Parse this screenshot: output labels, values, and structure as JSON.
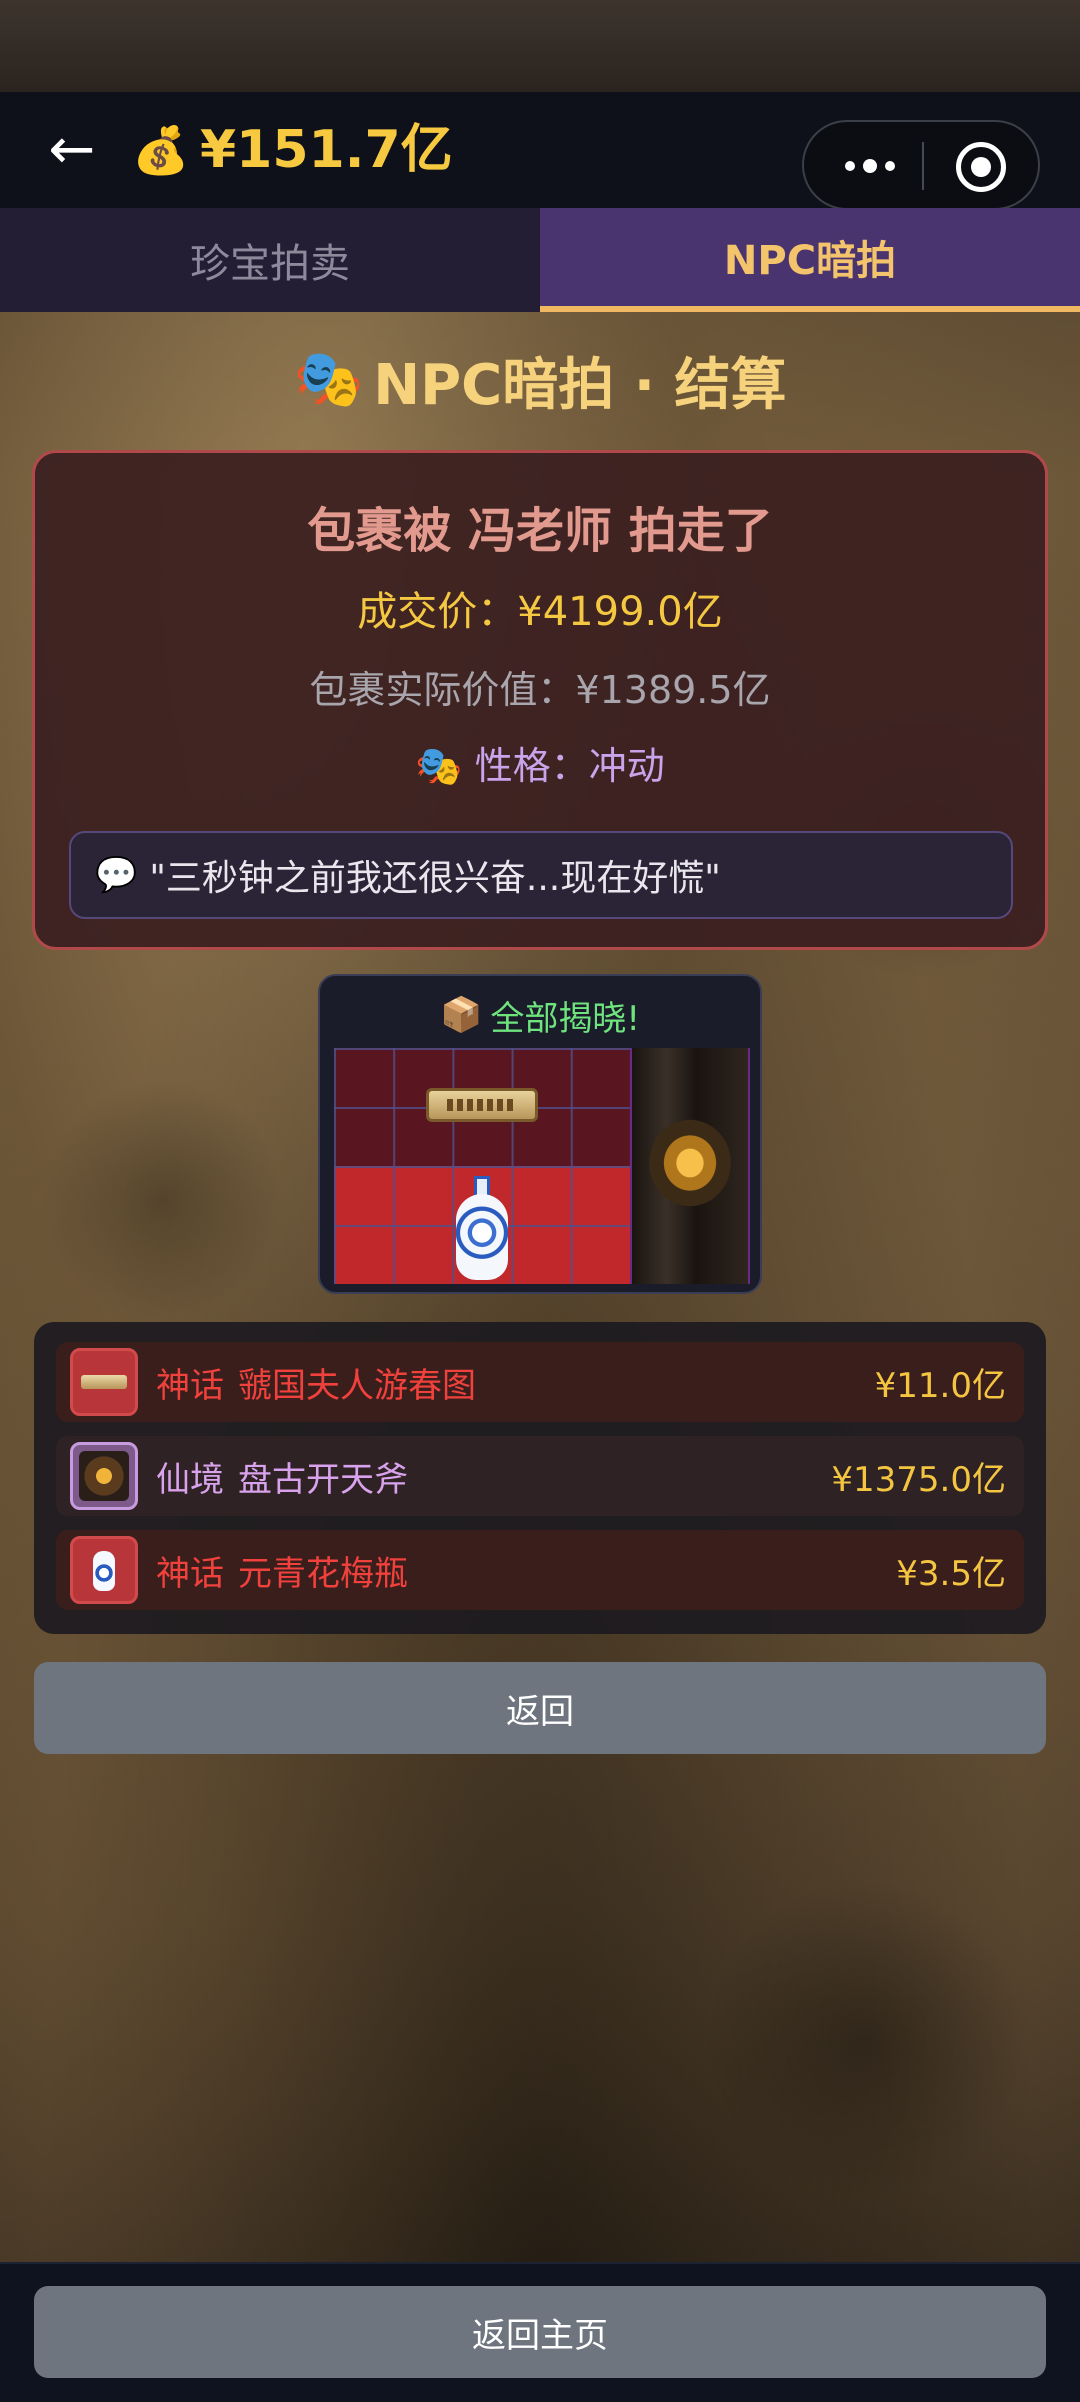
{
  "header": {
    "money_icon": "💰",
    "money_value": "¥151.7亿"
  },
  "tabs": [
    {
      "label": "珍宝拍卖",
      "active": false
    },
    {
      "label": "NPC暗拍",
      "active": true
    }
  ],
  "title": {
    "icon": "🎭",
    "text": "NPC暗拍 · 结算"
  },
  "result": {
    "winner_line": "包裹被 冯老师 拍走了",
    "deal_price": "成交价：¥4199.0亿",
    "real_value": "包裹实际价值：¥1389.5亿",
    "personality_icon": "🎭",
    "personality": "性格：冲动",
    "quote_icon": "💬",
    "quote": "\"三秒钟之前我还很兴奋...现在好慌\""
  },
  "reveal": {
    "icon": "📦",
    "title": "全部揭晓!"
  },
  "items": [
    {
      "tier": "神话",
      "name": "虢国夫人游春图",
      "price": "¥11.0亿"
    },
    {
      "tier": "仙境",
      "name": "盘古开天斧",
      "price": "¥1375.0亿"
    },
    {
      "tier": "神话",
      "name": "元青花梅瓶",
      "price": "¥3.5亿"
    }
  ],
  "buttons": {
    "back": "返回",
    "home": "返回主页"
  },
  "colors": {
    "accent_gold": "#f6c940",
    "tab_active_bg": "#4a3470",
    "tier_myth": "#f0413d",
    "tier_fairyland": "#d9a2ec"
  }
}
